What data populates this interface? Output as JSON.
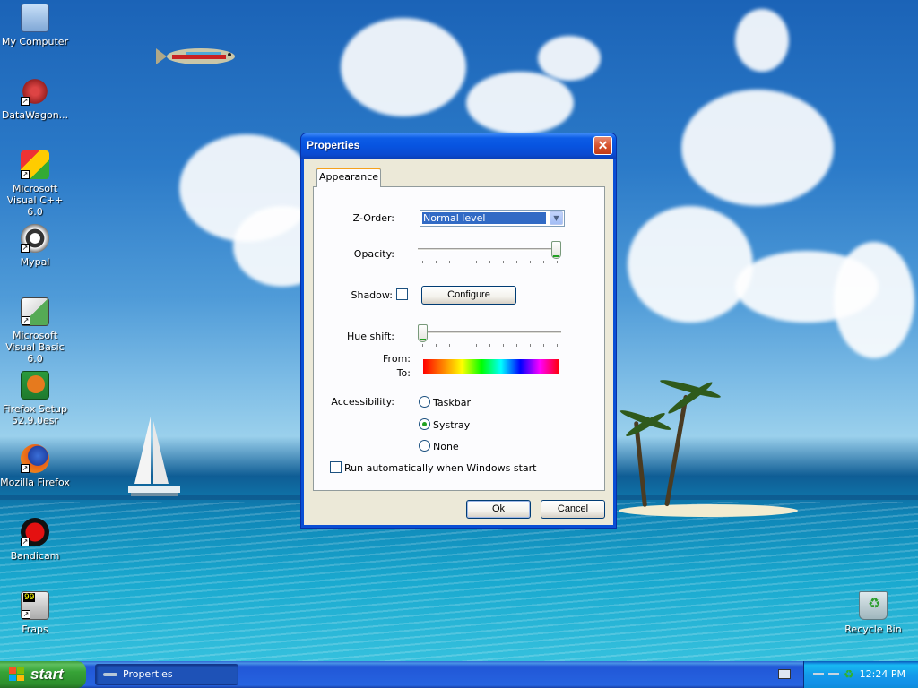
{
  "desktop": {
    "icons": [
      {
        "label": "My Computer"
      },
      {
        "label": "DataWagon..."
      },
      {
        "label": "Microsoft Visual C++ 6.0"
      },
      {
        "label": "Mypal"
      },
      {
        "label": "Microsoft Visual Basic 6.0"
      },
      {
        "label": "Firefox Setup 52.9.0esr"
      },
      {
        "label": "Mozilla Firefox"
      },
      {
        "label": "Bandicam"
      },
      {
        "label": "Fraps"
      }
    ],
    "recycle_bin": {
      "label": "Recycle Bin"
    }
  },
  "dialog": {
    "title": "Properties",
    "tab": "Appearance",
    "zorder": {
      "label": "Z-Order:",
      "value": "Normal level"
    },
    "opacity": {
      "label": "Opacity:",
      "level": 1.0
    },
    "shadow": {
      "label": "Shadow:",
      "checked": false,
      "configure_label": "Configure"
    },
    "hue_shift": {
      "label": "Hue shift:",
      "level": 0.0
    },
    "from_label": "From:",
    "to_label": "To:",
    "accessibility": {
      "label": "Accessibility:",
      "options": [
        "Taskbar",
        "Systray",
        "None"
      ],
      "selected": "Systray"
    },
    "autorun": {
      "label": "Run automatically when Windows start",
      "checked": false
    },
    "ok_label": "Ok",
    "cancel_label": "Cancel"
  },
  "taskbar": {
    "start_label": "start",
    "task_label": "Properties",
    "clock": "12:24 PM"
  }
}
